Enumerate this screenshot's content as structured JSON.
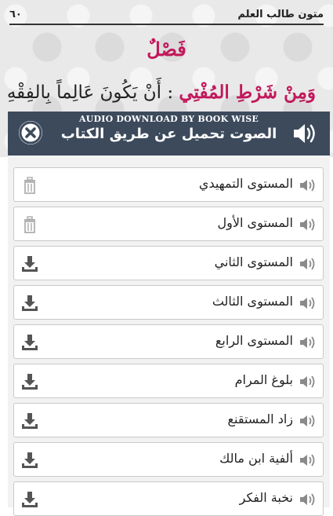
{
  "book": {
    "page_number": "٦٠",
    "header_title": "متون طالب العلم",
    "section_heading": "فَصْلٌ",
    "line_red": "وَمِنْ شَرْطِ المُفْتِي",
    "line_sep": ":",
    "line_dark": "أَنْ يَكُونَ عَالِماً بِالفِقْهِ"
  },
  "banner": {
    "subtitle": "AUDIO DOWNLOAD BY BOOK WISE",
    "title": "الصوت تحميل عن طريق الكتاب",
    "close_icon": "close-circle-icon",
    "speaker_icon": "speaker-icon"
  },
  "audio_list": [
    {
      "label": "المستوى التمهيدي",
      "action": "delete"
    },
    {
      "label": "المستوى الأول",
      "action": "delete"
    },
    {
      "label": "المستوى الثاني",
      "action": "download"
    },
    {
      "label": "المستوى الثالث",
      "action": "download"
    },
    {
      "label": "المستوى الرابع",
      "action": "download"
    },
    {
      "label": "بلوغ المرام",
      "action": "download"
    },
    {
      "label": "زاد المستقنع",
      "action": "download"
    },
    {
      "label": "ألفية ابن مالك",
      "action": "download"
    },
    {
      "label": "نخبة الفكر",
      "action": "download"
    }
  ],
  "colors": {
    "banner_bg": "#3c4a5c",
    "accent_red": "#c2185b",
    "icon_gray": "#8a8a8a",
    "download_dark": "#555555"
  }
}
